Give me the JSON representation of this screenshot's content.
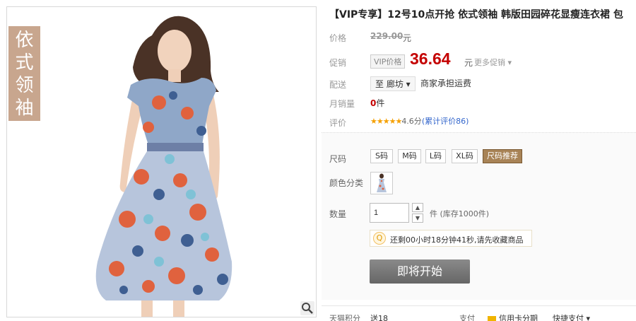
{
  "image": {
    "tag_text": "依式领袖",
    "zoom_icon": "magnifier-icon"
  },
  "product": {
    "title": "【VIP专享】12号10点开抢 依式领袖 韩版田园碎花显瘦连衣裙 包",
    "labels": {
      "price": "价格",
      "promo": "促销",
      "shipping": "配送",
      "sales": "月销量",
      "rating": "评价",
      "size": "尺码",
      "color": "颜色分类",
      "qty": "数量",
      "points": "天猫积分",
      "pay": "支付"
    },
    "original_price": "229.00",
    "currency_unit": "元",
    "vip_badge": "VIP价格",
    "promo_price": "36.64",
    "more_promo": "更多促销",
    "ship_to": "至 廊坊",
    "ship_note": "商家承担运费",
    "sales_count": "0",
    "sales_unit": "件",
    "stars": "★★★★★",
    "score": "4.6分",
    "review_link": "(累计评价86)"
  },
  "options": {
    "sizes": [
      "S码",
      "M码",
      "L码",
      "XL码",
      "尺码推荐"
    ],
    "color_swatch": "dress-thumbnail"
  },
  "quantity": {
    "value": "1",
    "unit_stock": "件 (库存1000件)"
  },
  "countdown": {
    "icon": "lightbulb-icon",
    "text": "还剩00小时18分钟41秒,请先收藏商品"
  },
  "buy_button": "即将开始",
  "footer": {
    "points_value": "送18",
    "credit": "信用卡分期",
    "quick_pay": "快捷支付"
  }
}
